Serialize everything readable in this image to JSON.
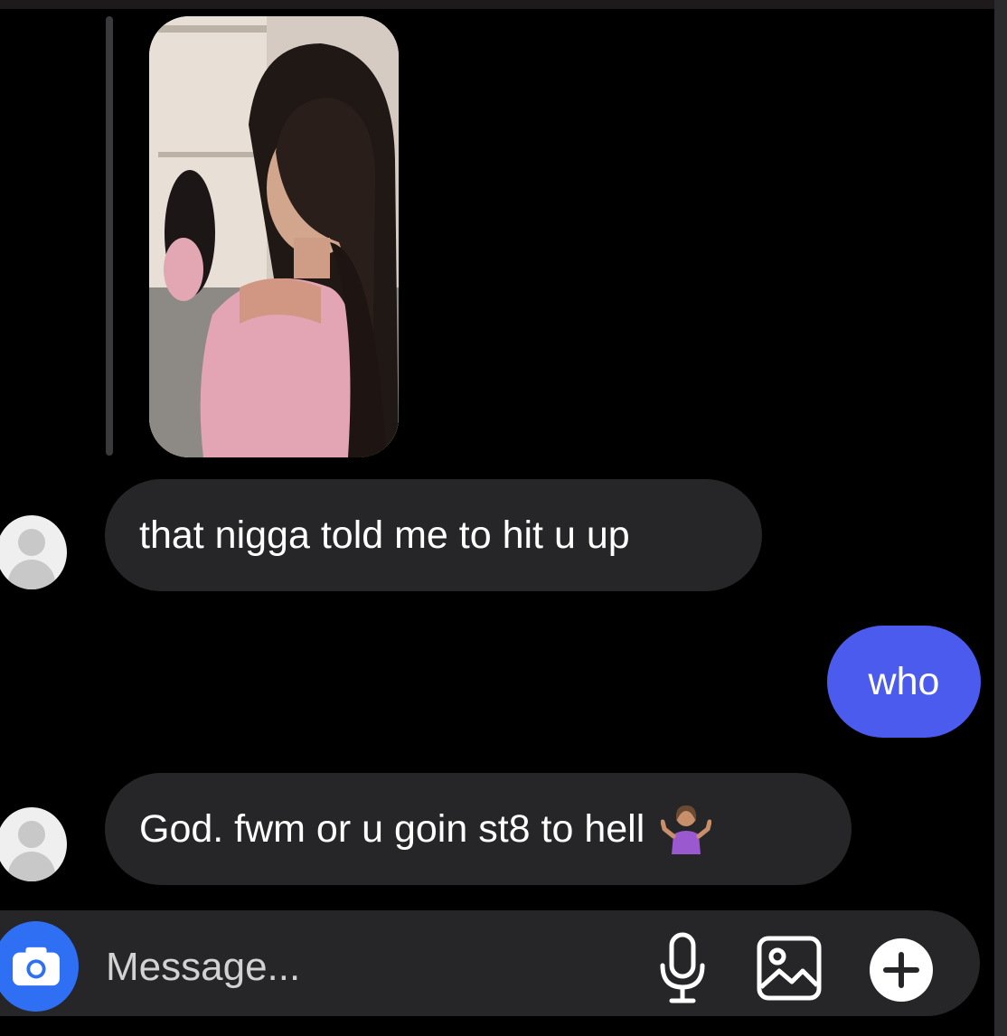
{
  "conversation": {
    "messages": [
      {
        "sender": "them",
        "text": "that nigga told me to hit u up"
      },
      {
        "sender": "me",
        "text": "who"
      },
      {
        "sender": "them",
        "text": "God. fwm or u goin st8 to hell",
        "emoji": "person-shrugging"
      }
    ]
  },
  "composer": {
    "placeholder": "Message...",
    "icons": [
      "camera-icon",
      "microphone-icon",
      "gallery-icon",
      "plus-icon"
    ]
  },
  "colors": {
    "background": "#000000",
    "incoming_bubble": "#262628",
    "outgoing_bubble": "#4a5bee",
    "camera_button": "#2f6ff3"
  }
}
